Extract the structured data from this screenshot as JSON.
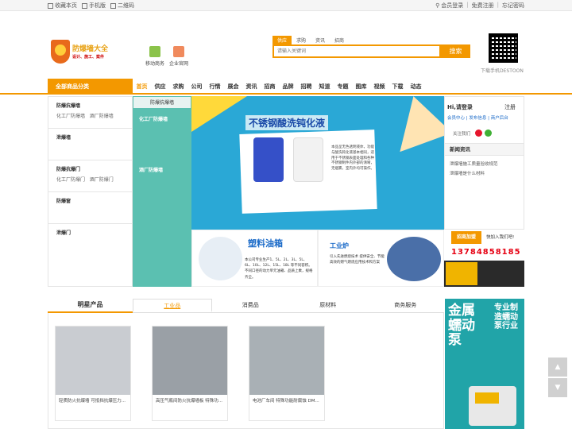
{
  "topbar": {
    "left": [
      {
        "label": "收藏本页",
        "icon": "bookmark-icon"
      },
      {
        "label": "手机版",
        "icon": "mobile-icon"
      },
      {
        "label": "二维码",
        "icon": "qrcode-icon"
      }
    ],
    "right": {
      "member_login": "会员登录",
      "register": "免费注册",
      "forgot": "忘记密码",
      "sep": "|"
    }
  },
  "logo": {
    "name": "防爆墙大全",
    "slogan": "设计、施工、案件"
  },
  "quick": [
    {
      "label": "移动商务",
      "color": "#8bc34a"
    },
    {
      "label": "企业官网",
      "color": "#f08a5d"
    }
  ],
  "search": {
    "tabs": [
      "供应",
      "求购",
      "资讯",
      "招商"
    ],
    "active_tab": 0,
    "placeholder": "请输入关键词",
    "button": "搜索"
  },
  "qr": {
    "label": "下载手机DESTOON"
  },
  "nav": {
    "all_categories": "全部商品分类",
    "items": [
      "首页",
      "供应",
      "求购",
      "公司",
      "行情",
      "展会",
      "资讯",
      "招商",
      "品牌",
      "招聘",
      "知道",
      "专题",
      "图库",
      "视频",
      "下载",
      "动态"
    ],
    "active": 0
  },
  "categories": [
    {
      "title": "防爆抗爆墙",
      "subs": [
        "化工厂防爆墙",
        "酒厂防爆墙"
      ]
    },
    {
      "title": "泄爆墙",
      "subs": []
    },
    {
      "title": "防爆抗爆门",
      "subs": [
        "化工厂防爆门",
        "酒厂防爆门"
      ]
    },
    {
      "title": "防爆窗",
      "subs": []
    },
    {
      "title": "泄爆门",
      "subs": []
    }
  ],
  "subpanel": {
    "head": "防爆抗爆墙",
    "items": [
      "化工厂防爆墙",
      "酒厂防爆墙"
    ]
  },
  "banner": {
    "title": "不锈钢酸洗钝化液",
    "desc": "本品呈无色透明液体，功能与酸洗钝化液基本相同，适用于不锈钢表面处理和各种不锈钢制件内外部的清晰，无烟雾，室内外均可操作。"
  },
  "ads": [
    {
      "title": "塑料油箱",
      "desc": "本公司专业生产1、5L、2L、3L、5L、6L、10L、12L、15L、18L 等不同容积。不同口径的动力单元油箱、品质上乘，规格齐全。"
    },
    {
      "title": "工业炉",
      "desc": "引入先进燃烧技术 提供安全、节能高效的燃气燃烧应用技术和方案"
    }
  ],
  "login": {
    "hello": "Hi,请登录",
    "register": "注册",
    "links": [
      "会员中心",
      "发布信息",
      "商户后台"
    ],
    "follow": "关注我们",
    "news_title": "新闻资讯",
    "news": [
      "泄爆墙施工质量验收规范",
      "泄爆墙是什么材料"
    ]
  },
  "join": {
    "button": "招商加盟",
    "question": "快加入我们吧!",
    "phone": "13784858185"
  },
  "products": {
    "title": "明星产品",
    "tabs": [
      "工业品",
      "消费品",
      "原材料",
      "商务服务"
    ],
    "active_tab": 0,
    "items": [
      {
        "caption": "轻质防火抗爆墙 可抵挡抗爆压力...",
        "color": "#c9ccd1"
      },
      {
        "caption": "高压气瓶间防火抗爆墙板 特殊功...",
        "color": "#9aa0a6"
      },
      {
        "caption": "电池厂车间 特殊功能耐腐蚀 DM...",
        "color": "#a9b0b5"
      }
    ]
  },
  "sidead": {
    "big": "金属蠕动泵",
    "small": "专业制造蠕动泵行业"
  }
}
